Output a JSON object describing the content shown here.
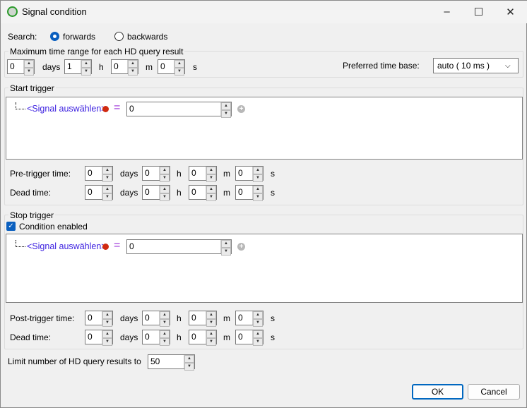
{
  "window": {
    "title": "Signal condition",
    "minimize": "–",
    "maximize": "☐",
    "close": "✕"
  },
  "search": {
    "label": "Search:",
    "options": [
      {
        "label": "forwards",
        "selected": true
      },
      {
        "label": "backwards",
        "selected": false
      }
    ]
  },
  "max_range": {
    "title": "Maximum time range for each HD query result",
    "days": "0",
    "h": "1",
    "m": "0",
    "s": "0",
    "pref_label": "Preferred time base:",
    "pref_value": "auto ( 10 ms )"
  },
  "units": {
    "days": "days",
    "h": "h",
    "m": "m",
    "s": "s"
  },
  "start": {
    "title": "Start trigger",
    "signal": "<Signal auswählen>",
    "eq": "=",
    "value": "0",
    "rows": [
      {
        "label": "Pre-trigger time:",
        "days": "0",
        "h": "0",
        "m": "0",
        "s": "0"
      },
      {
        "label": "Dead time:",
        "days": "0",
        "h": "0",
        "m": "0",
        "s": "0"
      }
    ]
  },
  "stop": {
    "title": "Stop trigger",
    "enabled_label": "Condition enabled",
    "signal": "<Signal auswählen>",
    "eq": "=",
    "value": "0",
    "rows": [
      {
        "label": "Post-trigger time:",
        "days": "0",
        "h": "0",
        "m": "0",
        "s": "0"
      },
      {
        "label": "Dead time:",
        "days": "0",
        "h": "0",
        "m": "0",
        "s": "0"
      }
    ]
  },
  "limit": {
    "label": "Limit number of HD query results to",
    "value": "50"
  },
  "buttons": {
    "ok": "OK",
    "cancel": "Cancel"
  }
}
